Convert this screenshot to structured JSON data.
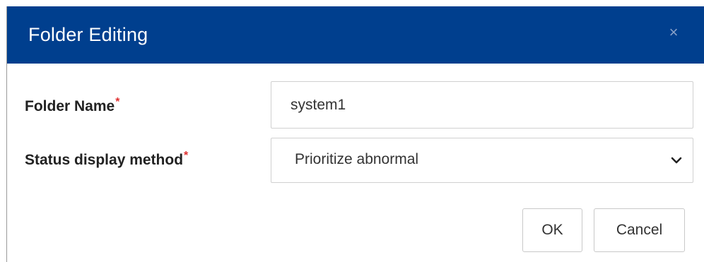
{
  "dialog": {
    "title": "Folder Editing",
    "close_symbol": "×"
  },
  "form": {
    "folder_name": {
      "label": "Folder Name",
      "required_marker": "*",
      "value": "system1"
    },
    "status_display_method": {
      "label": "Status display method",
      "required_marker": "*",
      "selected": "Prioritize abnormal"
    }
  },
  "buttons": {
    "ok": "OK",
    "cancel": "Cancel"
  },
  "colors": {
    "header_bg": "#003f8e",
    "required": "#e03030"
  },
  "icons": {
    "close": "close-icon",
    "dropdown": "chevron-down-icon"
  }
}
